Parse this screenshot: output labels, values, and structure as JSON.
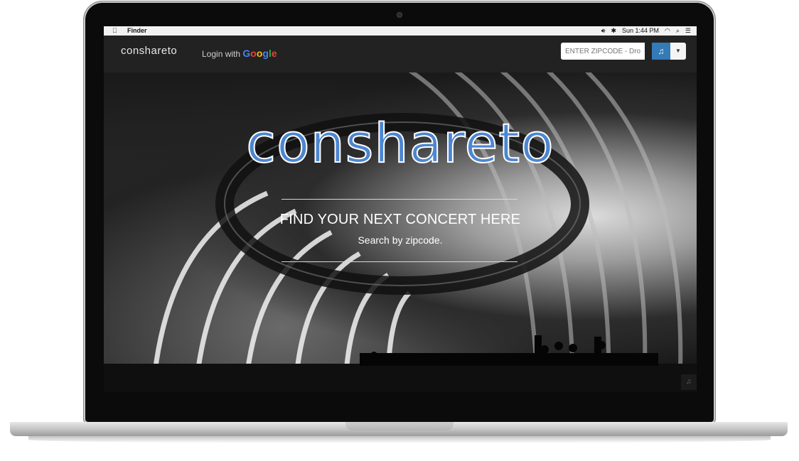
{
  "menubar": {
    "apple_icon": "apple-logo-icon",
    "app_name": "Finder",
    "clock": "Sun 1:44 PM"
  },
  "navbar": {
    "brand": "conshareto",
    "login_prefix": "Login with",
    "login_provider": [
      "G",
      "o",
      "o",
      "g",
      "l",
      "e"
    ],
    "zip_placeholder": "ENTER ZIPCODE - Dropdown"
  },
  "hero": {
    "title": "conshareto",
    "heading": "FIND YOUR NEXT CONCERT HERE",
    "subheading": "Search by zipcode."
  },
  "colors": {
    "accent": "#337ab7",
    "title_blue": "#4d86d1",
    "navbar": "#222222"
  }
}
